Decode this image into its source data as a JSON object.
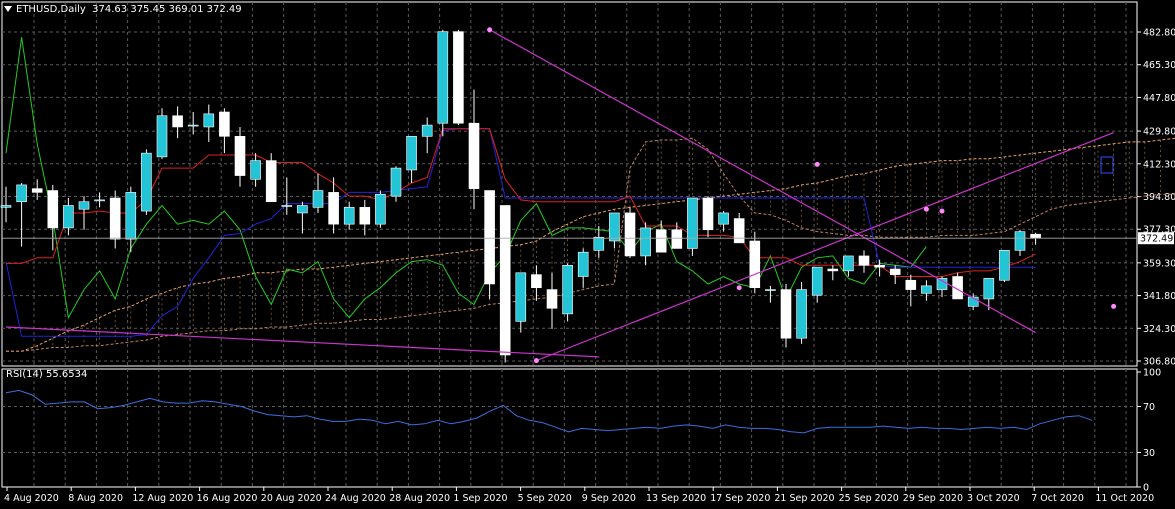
{
  "header": {
    "symbol": "ETHUSD,Daily",
    "ohlc": "374.63 375.45 369.01 372.49"
  },
  "rsi": {
    "label": "RSI(14) 55.6534",
    "ticks": [
      "100",
      "70",
      "30",
      "0"
    ],
    "values": [
      82,
      84,
      80,
      72,
      73,
      74,
      74,
      68,
      69,
      71,
      74,
      77,
      74,
      73,
      73,
      75,
      74,
      72,
      70,
      66,
      63,
      62,
      61,
      62,
      59,
      57,
      57,
      59,
      58,
      55,
      57,
      54,
      55,
      58,
      55,
      57,
      60,
      66,
      71,
      62,
      58,
      56,
      52,
      48,
      51,
      50,
      49,
      50,
      51,
      52,
      51,
      53,
      54,
      53,
      51,
      54,
      52,
      51,
      51,
      50,
      48,
      47,
      51,
      52,
      52,
      52,
      52,
      53,
      52,
      51,
      52,
      51,
      51,
      50,
      51,
      52,
      51,
      52,
      50,
      55,
      58,
      61,
      62,
      58
    ]
  },
  "chart_data": {
    "type": "candlestick",
    "symbol": "ETHUSD",
    "timeframe": "Daily",
    "ylim": [
      306.8,
      482.8
    ],
    "y_ticks": [
      "482.80",
      "465.30",
      "447.80",
      "429.80",
      "412.30",
      "394.80",
      "377.30",
      "359.30",
      "341.80",
      "324.30",
      "306.80"
    ],
    "current_price": "372.49",
    "x_labels": [
      "4 Aug 2020",
      "8 Aug 2020",
      "12 Aug 2020",
      "16 Aug 2020",
      "20 Aug 2020",
      "24 Aug 2020",
      "28 Aug 2020",
      "1 Sep 2020",
      "5 Sep 2020",
      "9 Sep 2020",
      "13 Sep 2020",
      "17 Sep 2020",
      "21 Sep 2020",
      "25 Sep 2020",
      "29 Sep 2020",
      "3 Oct 2020",
      "7 Oct 2020",
      "11 Oct 2020"
    ],
    "candles": [
      {
        "o": 389,
        "h": 400,
        "l": 381,
        "c": 390
      },
      {
        "o": 392,
        "h": 402,
        "l": 368,
        "c": 401
      },
      {
        "o": 399,
        "h": 404,
        "l": 393,
        "c": 397
      },
      {
        "o": 398,
        "h": 401,
        "l": 366,
        "c": 378
      },
      {
        "o": 378,
        "h": 394,
        "l": 374,
        "c": 390
      },
      {
        "o": 388,
        "h": 395,
        "l": 377,
        "c": 392
      },
      {
        "o": 393,
        "h": 397,
        "l": 389,
        "c": 393
      },
      {
        "o": 394,
        "h": 398,
        "l": 367,
        "c": 372
      },
      {
        "o": 372,
        "h": 400,
        "l": 365,
        "c": 397
      },
      {
        "o": 387,
        "h": 420,
        "l": 385,
        "c": 418
      },
      {
        "o": 416,
        "h": 442,
        "l": 415,
        "c": 438
      },
      {
        "o": 438,
        "h": 443,
        "l": 426,
        "c": 432
      },
      {
        "o": 433,
        "h": 440,
        "l": 428,
        "c": 433
      },
      {
        "o": 432,
        "h": 444,
        "l": 424,
        "c": 439
      },
      {
        "o": 440,
        "h": 442,
        "l": 418,
        "c": 427
      },
      {
        "o": 427,
        "h": 432,
        "l": 400,
        "c": 406
      },
      {
        "o": 404,
        "h": 418,
        "l": 400,
        "c": 414
      },
      {
        "o": 414,
        "h": 418,
        "l": 394,
        "c": 392
      },
      {
        "o": 390,
        "h": 405,
        "l": 385,
        "c": 390
      },
      {
        "o": 386,
        "h": 392,
        "l": 375,
        "c": 390
      },
      {
        "o": 389,
        "h": 407,
        "l": 386,
        "c": 398
      },
      {
        "o": 397,
        "h": 405,
        "l": 375,
        "c": 380
      },
      {
        "o": 380,
        "h": 392,
        "l": 377,
        "c": 389
      },
      {
        "o": 389,
        "h": 393,
        "l": 374,
        "c": 380
      },
      {
        "o": 380,
        "h": 398,
        "l": 378,
        "c": 396
      },
      {
        "o": 395,
        "h": 411,
        "l": 392,
        "c": 410
      },
      {
        "o": 409,
        "h": 426,
        "l": 402,
        "c": 427
      },
      {
        "o": 427,
        "h": 437,
        "l": 418,
        "c": 433
      },
      {
        "o": 434,
        "h": 484,
        "l": 427,
        "c": 483
      },
      {
        "o": 483,
        "h": 484,
        "l": 433,
        "c": 434
      },
      {
        "o": 434,
        "h": 452,
        "l": 388,
        "c": 399
      },
      {
        "o": 398,
        "h": 398,
        "l": 340,
        "c": 348
      },
      {
        "o": 390,
        "h": 390,
        "l": 306,
        "c": 310
      },
      {
        "o": 328,
        "h": 354,
        "l": 322,
        "c": 354
      },
      {
        "o": 353,
        "h": 358,
        "l": 339,
        "c": 346
      },
      {
        "o": 345,
        "h": 354,
        "l": 324,
        "c": 335
      },
      {
        "o": 332,
        "h": 359,
        "l": 328,
        "c": 358
      },
      {
        "o": 352,
        "h": 367,
        "l": 346,
        "c": 365
      },
      {
        "o": 366,
        "h": 379,
        "l": 362,
        "c": 373
      },
      {
        "o": 371,
        "h": 385,
        "l": 367,
        "c": 386
      },
      {
        "o": 386,
        "h": 389,
        "l": 362,
        "c": 363
      },
      {
        "o": 363,
        "h": 381,
        "l": 358,
        "c": 378
      },
      {
        "o": 377,
        "h": 382,
        "l": 365,
        "c": 365
      },
      {
        "o": 377,
        "h": 381,
        "l": 367,
        "c": 367
      },
      {
        "o": 367,
        "h": 394,
        "l": 363,
        "c": 394
      },
      {
        "o": 394,
        "h": 395,
        "l": 373,
        "c": 377
      },
      {
        "o": 380,
        "h": 387,
        "l": 376,
        "c": 386
      },
      {
        "o": 383,
        "h": 386,
        "l": 370,
        "c": 370
      },
      {
        "o": 371,
        "h": 376,
        "l": 343,
        "c": 346
      },
      {
        "o": 345,
        "h": 347,
        "l": 338,
        "c": 345
      },
      {
        "o": 345,
        "h": 348,
        "l": 314,
        "c": 319
      },
      {
        "o": 319,
        "h": 349,
        "l": 316,
        "c": 345
      },
      {
        "o": 342,
        "h": 356,
        "l": 338,
        "c": 357
      },
      {
        "o": 356,
        "h": 358,
        "l": 350,
        "c": 355
      },
      {
        "o": 355,
        "h": 360,
        "l": 352,
        "c": 363
      },
      {
        "o": 363,
        "h": 366,
        "l": 354,
        "c": 358
      },
      {
        "o": 358,
        "h": 361,
        "l": 352,
        "c": 357
      },
      {
        "o": 356,
        "h": 358,
        "l": 348,
        "c": 353
      },
      {
        "o": 350,
        "h": 353,
        "l": 336,
        "c": 345
      },
      {
        "o": 343,
        "h": 350,
        "l": 339,
        "c": 347
      },
      {
        "o": 345,
        "h": 352,
        "l": 341,
        "c": 351
      },
      {
        "o": 352,
        "h": 354,
        "l": 340,
        "c": 340
      },
      {
        "o": 336,
        "h": 343,
        "l": 334,
        "c": 341
      },
      {
        "o": 340,
        "h": 350,
        "l": 334,
        "c": 351
      },
      {
        "o": 350,
        "h": 366,
        "l": 349,
        "c": 366
      },
      {
        "o": 366,
        "h": 377,
        "l": 363,
        "c": 376
      },
      {
        "o": 374.63,
        "h": 375.45,
        "l": 369.01,
        "c": 372.49
      }
    ],
    "tenkan": [
      359,
      359,
      362,
      362,
      386,
      386,
      387,
      386,
      386,
      393,
      410,
      410,
      410,
      417,
      417,
      417,
      417,
      413,
      413,
      413,
      407,
      402,
      395,
      395,
      393,
      397,
      402,
      405,
      431,
      431,
      431,
      431,
      404,
      393,
      392,
      392,
      392,
      392,
      392,
      392,
      395,
      379,
      379,
      379,
      374,
      374,
      374,
      373,
      362,
      362,
      362,
      358,
      358,
      358,
      358,
      358,
      358,
      352,
      352,
      352,
      352,
      354,
      355,
      355,
      357,
      360,
      364
    ],
    "kijun": [
      360,
      320,
      320,
      320,
      320,
      320,
      320,
      320,
      320,
      321,
      331,
      336,
      351,
      362,
      374,
      375,
      380,
      383,
      391,
      391,
      391,
      391,
      397,
      397,
      397,
      398,
      399,
      400,
      430,
      431,
      431,
      431,
      394,
      394,
      394,
      394,
      394,
      394,
      394,
      394,
      394,
      394,
      394,
      394,
      394,
      394,
      394,
      394,
      394,
      394,
      394,
      394,
      394,
      394,
      394,
      394,
      358,
      357,
      357,
      357,
      357,
      357,
      357,
      357,
      357,
      357,
      357
    ],
    "chikou": [
      418,
      480,
      423,
      383,
      330,
      345,
      355,
      340,
      367,
      380,
      390,
      380,
      382,
      380,
      387,
      377,
      352,
      337,
      356,
      354,
      360,
      340,
      330,
      340,
      346,
      354,
      360,
      361,
      358,
      343,
      337,
      354,
      363,
      382,
      391,
      374,
      378,
      378,
      377,
      376,
      365,
      376,
      380,
      360,
      355,
      348,
      352,
      348,
      346,
      363,
      340,
      357,
      362,
      363,
      351,
      348,
      359,
      358,
      357,
      368
    ],
    "senkou_a": [
      312,
      312,
      315,
      319,
      323,
      326,
      330,
      334,
      336,
      340,
      343,
      346,
      348,
      349,
      351,
      352,
      354,
      354,
      355,
      356,
      356,
      357,
      358,
      359,
      360,
      361,
      362,
      363,
      364,
      365,
      366,
      367,
      368,
      369,
      371,
      376,
      380,
      384,
      386,
      388,
      389,
      390,
      391,
      392,
      393,
      394,
      395,
      396,
      397,
      398,
      399,
      401,
      402,
      404,
      406,
      407,
      409,
      411,
      412,
      413,
      414,
      414,
      415,
      415,
      416,
      417,
      418,
      419,
      420,
      421,
      422,
      423,
      424,
      424,
      425,
      426
    ],
    "senkou_b": [
      312,
      312,
      313,
      314,
      314,
      315,
      315,
      316,
      317,
      318,
      320,
      321,
      322,
      323,
      323,
      324,
      324,
      325,
      325,
      326,
      327,
      327,
      328,
      329,
      329,
      330,
      331,
      332,
      333,
      334,
      335,
      337,
      338,
      339,
      340,
      341,
      343,
      345,
      347,
      348,
      410,
      424,
      425,
      425,
      426,
      420,
      407,
      395,
      386,
      385,
      382,
      378,
      376,
      375,
      374,
      374,
      373,
      373,
      373,
      373,
      374,
      374,
      374,
      375,
      376,
      380,
      384,
      388,
      390,
      391,
      392,
      393,
      394,
      395,
      396,
      396
    ],
    "trendlines": [
      {
        "from": [
          0,
          325
        ],
        "to": [
          38,
          309
        ],
        "color": "#cc33cc"
      },
      {
        "from": [
          31,
          484
        ],
        "to": [
          66,
          322
        ],
        "color": "#cc33cc"
      },
      {
        "from": [
          34,
          307
        ],
        "to": [
          71,
          429
        ],
        "color": "#cc33cc"
      }
    ],
    "trendline_points": [
      {
        "i": 31,
        "v": 484
      },
      {
        "i": 34,
        "v": 307
      },
      {
        "i": 47,
        "v": 346
      },
      {
        "i": 52,
        "v": 412
      },
      {
        "i": 59,
        "v": 388
      },
      {
        "i": 60,
        "v": 387
      },
      {
        "i": 71,
        "v": 336
      }
    ]
  }
}
